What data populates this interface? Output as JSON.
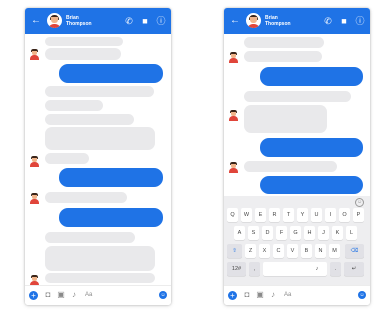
{
  "contact": {
    "first_name": "Brian",
    "last_name": "Thompson"
  },
  "colors": {
    "accent": "#1f73e6",
    "bubble_gray": "#e9e9eb",
    "keyboard_bg": "#eeeef0"
  },
  "icons": {
    "back": "←",
    "call": "✆",
    "video": "■",
    "info": "ⓘ",
    "plus": "+",
    "camera": "◘",
    "gallery": "▣",
    "mic": "♪",
    "emoji": "☺",
    "shift": "⇧",
    "backspace": "⌫",
    "enter": "↵",
    "keyboard_mic": "♪"
  },
  "compose": {
    "placeholder": "Aa"
  },
  "keyboard": {
    "row1": [
      "Q",
      "W",
      "E",
      "R",
      "T",
      "Y",
      "U",
      "I",
      "O",
      "P"
    ],
    "row2": [
      "A",
      "S",
      "D",
      "F",
      "G",
      "H",
      "J",
      "K",
      "L"
    ],
    "row3": [
      "Z",
      "X",
      "C",
      "V",
      "B",
      "N",
      "M"
    ],
    "numbers_key": "12#",
    "comma_key": ",",
    "period_key": "."
  }
}
